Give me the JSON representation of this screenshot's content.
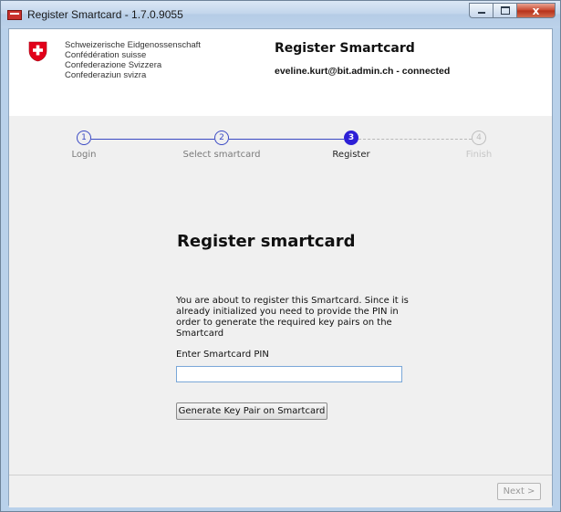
{
  "window": {
    "title": "Register Smartcard - 1.7.0.9055",
    "close_glyph": "x"
  },
  "header": {
    "confederation": [
      "Schweizerische Eidgenossenschaft",
      "Confédération suisse",
      "Confederazione Svizzera",
      "Confederaziun svizra"
    ],
    "title": "Register Smartcard",
    "user_status": "eveline.kurt@bit.admin.ch - connected"
  },
  "steps": [
    {
      "number": "1",
      "label": "Login",
      "state": "done"
    },
    {
      "number": "2",
      "label": "Select smartcard",
      "state": "done"
    },
    {
      "number": "3",
      "label": "Register",
      "state": "active"
    },
    {
      "number": "4",
      "label": "Finish",
      "state": "pending"
    }
  ],
  "main": {
    "title": "Register smartcard",
    "description": "You are about to register this Smartcard. Since it is already initialized you need to provide the PIN in order to generate the required key pairs on the Smartcard",
    "pin_label": "Enter Smartcard PIN",
    "pin_value": "",
    "generate_button": "Generate Key Pair on Smartcard"
  },
  "footer": {
    "next_button": "Next >"
  },
  "colors": {
    "accent": "#2d1fd6",
    "swiss_red": "#e2001a"
  },
  "icons": {
    "app": "swiss-flag-icon",
    "header_logo": "swiss-flag-icon"
  }
}
